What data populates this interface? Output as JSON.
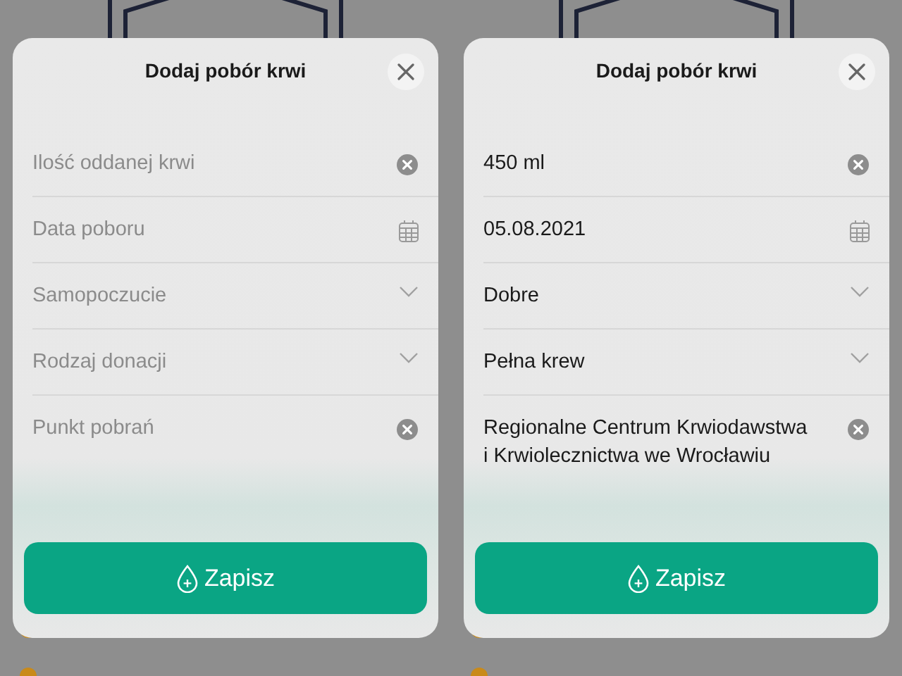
{
  "screens": [
    {
      "title": "Dodaj pobór krwi",
      "fields": [
        {
          "kind": "clear",
          "placeholder": "Ilość oddanej krwi"
        },
        {
          "kind": "date",
          "placeholder": "Data poboru"
        },
        {
          "kind": "select",
          "placeholder": "Samopoczucie"
        },
        {
          "kind": "select",
          "placeholder": "Rodzaj donacji"
        },
        {
          "kind": "clear",
          "placeholder": "Punkt pobrań"
        }
      ],
      "button": "Zapisz"
    },
    {
      "title": "Dodaj pobór krwi",
      "fields": [
        {
          "kind": "clear",
          "value": "450 ml"
        },
        {
          "kind": "date",
          "value": "05.08.2021"
        },
        {
          "kind": "select",
          "value": "Dobre"
        },
        {
          "kind": "select",
          "value": "Pełna krew"
        },
        {
          "kind": "clear",
          "value": "Regionalne Centrum Krwiodawstwa i Krwiolecznictwa we Wrocławiu"
        }
      ],
      "button": "Zapisz"
    }
  ]
}
